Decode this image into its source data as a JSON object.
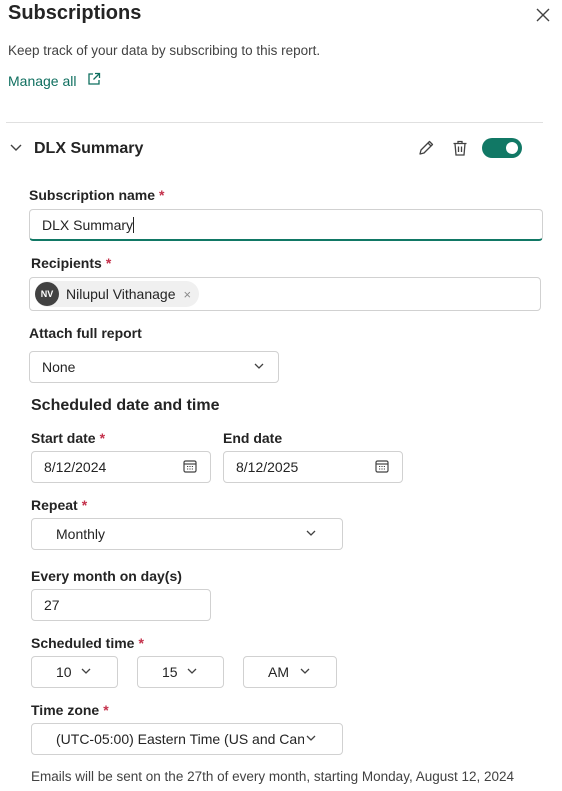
{
  "header": {
    "title": "Subscriptions",
    "description": "Keep track of your data by subscribing to this report.",
    "manage_all": "Manage all"
  },
  "subscription": {
    "name": "DLX Summary",
    "enabled": true,
    "form": {
      "name_label": "Subscription name",
      "name_value": "DLX Summary",
      "recipients_label": "Recipients",
      "recipient": {
        "initials": "NV",
        "name": "Nilupul Vithanage",
        "remove": "×"
      },
      "attach_label": "Attach full report",
      "attach_value": "None",
      "schedule_heading": "Scheduled date and time",
      "start_label": "Start date",
      "start_value": "8/12/2024",
      "end_label": "End date",
      "end_value": "8/12/2025",
      "repeat_label": "Repeat",
      "repeat_value": "Monthly",
      "day_label": "Every month on day(s)",
      "day_value": "27",
      "time_label": "Scheduled time",
      "hour_value": "10",
      "minute_value": "15",
      "ampm_value": "AM",
      "tz_label": "Time zone",
      "tz_value": "(UTC-05:00) Eastern Time (US and Cana",
      "required_mark": "*"
    }
  },
  "footer": {
    "summary": "Emails will be sent on the 27th of every month, starting Monday, August 12, 2024"
  },
  "colors": {
    "accent": "#117865",
    "link": "#0f6f5f",
    "required": "#c4314b"
  }
}
